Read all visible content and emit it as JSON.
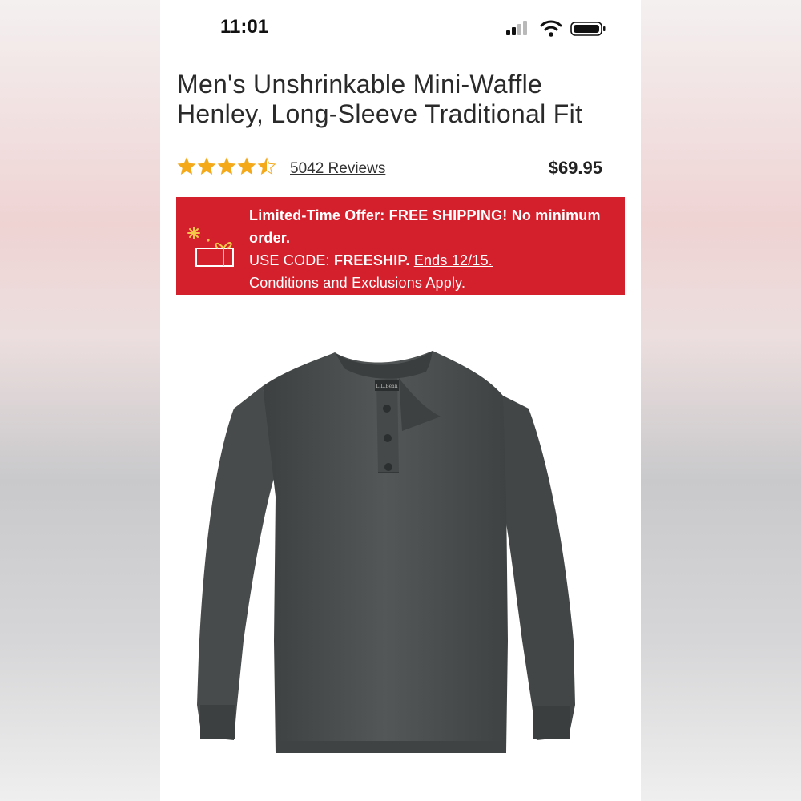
{
  "status_bar": {
    "time": "11:01",
    "signal_icon": "cellular-signal-icon",
    "wifi_icon": "wifi-icon",
    "battery_icon": "battery-icon"
  },
  "product": {
    "title": "Men's Unshrinkable Mini-Waffle Henley, Long-Sleeve Traditional Fit",
    "rating": 4.5,
    "rating_max": 5,
    "reviews_label": "5042 Reviews",
    "price": "$69.95",
    "image_icon": "henley-shirt-image",
    "label_text": "L.L.Bean"
  },
  "promo": {
    "headline": "Limited-Time Offer: FREE SHIPPING! No minimum order.",
    "code_label": "USE CODE: ",
    "code": "FREESHIP.",
    "ends": "Ends 12/15.",
    "conditions": "Conditions and Exclusions Apply.",
    "icon": "gift-box-icon"
  },
  "colors": {
    "promo_bg": "#d4202c",
    "star": "#f3a91a",
    "shirt": "#4a4e4e"
  }
}
